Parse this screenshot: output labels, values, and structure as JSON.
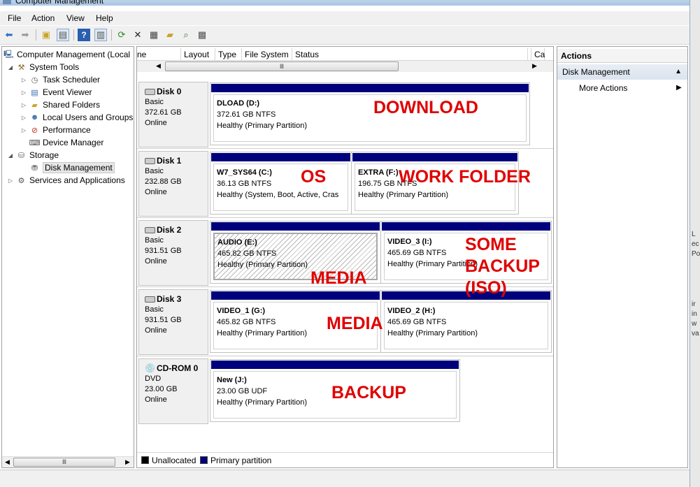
{
  "window": {
    "title": "Computer Management"
  },
  "menu": [
    "File",
    "Action",
    "View",
    "Help"
  ],
  "tree": {
    "items": [
      {
        "label": "Computer Management (Local",
        "level": 0,
        "icon": "computer-icon",
        "twisty": ""
      },
      {
        "label": "System Tools",
        "level": 1,
        "icon": "tools-icon",
        "twisty": "◢"
      },
      {
        "label": "Task Scheduler",
        "level": 2,
        "icon": "clock-icon",
        "twisty": "▷"
      },
      {
        "label": "Event Viewer",
        "level": 2,
        "icon": "event-viewer-icon",
        "twisty": "▷"
      },
      {
        "label": "Shared Folders",
        "level": 2,
        "icon": "shared-folder-icon",
        "twisty": "▷"
      },
      {
        "label": "Local Users and Groups",
        "level": 2,
        "icon": "users-icon",
        "twisty": "▷"
      },
      {
        "label": "Performance",
        "level": 2,
        "icon": "performance-icon",
        "twisty": "▷"
      },
      {
        "label": "Device Manager",
        "level": 2,
        "icon": "device-manager-icon",
        "twisty": ""
      },
      {
        "label": "Storage",
        "level": 1,
        "icon": "storage-icon",
        "twisty": "◢"
      },
      {
        "label": "Disk Management",
        "level": 2,
        "icon": "disk-icon",
        "twisty": "",
        "selected": true
      },
      {
        "label": "Services and Applications",
        "level": 1,
        "icon": "services-icon",
        "twisty": "▷"
      }
    ],
    "scroll_thumb_glyph": "Ⅲ"
  },
  "columns": [
    "ne",
    "Layout",
    "Type",
    "File System",
    "Status",
    "Ca"
  ],
  "hscroll_glyph": "Ⅲ",
  "disks": [
    {
      "name": "Disk 0",
      "type": "Basic",
      "size": "372.61 GB",
      "status": "Online",
      "partitions": [
        {
          "name": "DLOAD  (D:)",
          "size_fs": "372.61 GB NTFS",
          "health": "Healthy (Primary Partition)",
          "hatched": false
        }
      ]
    },
    {
      "name": "Disk 1",
      "type": "Basic",
      "size": "232.88 GB",
      "status": "Online",
      "partitions": [
        {
          "name": "W7_SYS64  (C:)",
          "size_fs": "36.13 GB NTFS",
          "health": "Healthy (System, Boot, Active, Cras",
          "hatched": false
        },
        {
          "name": "EXTRA  (F:)",
          "size_fs": "196.75 GB NTFS",
          "health": "Healthy (Primary Partition)",
          "hatched": false
        }
      ]
    },
    {
      "name": "Disk 2",
      "type": "Basic",
      "size": "931.51 GB",
      "status": "Online",
      "partitions": [
        {
          "name": "AUDIO  (E:)",
          "size_fs": "465.82 GB NTFS",
          "health": "Healthy (Primary Partition)",
          "hatched": true
        },
        {
          "name": "VIDEO_3  (I:)",
          "size_fs": "465.69 GB NTFS",
          "health": "Healthy (Primary Partition)",
          "hatched": false
        }
      ]
    },
    {
      "name": "Disk 3",
      "type": "Basic",
      "size": "931.51 GB",
      "status": "Online",
      "partitions": [
        {
          "name": "VIDEO_1  (G:)",
          "size_fs": "465.82 GB NTFS",
          "health": "Healthy (Primary Partition)",
          "hatched": false
        },
        {
          "name": "VIDEO_2  (H:)",
          "size_fs": "465.69 GB NTFS",
          "health": "Healthy (Primary Partition)",
          "hatched": false
        }
      ]
    },
    {
      "name": "CD-ROM 0",
      "type": "DVD",
      "size": "23.00 GB",
      "status": "Online",
      "partitions": [
        {
          "name": "New  (J:)",
          "size_fs": "23.00 GB UDF",
          "health": "Healthy (Primary Partition)",
          "hatched": false
        }
      ]
    }
  ],
  "annotations": {
    "download": "DOWNLOAD",
    "os": "OS",
    "work_folder": "WORK FOLDER",
    "some_backup": "SOME\nBACKUP\n(ISO)",
    "media_1": "MEDIA",
    "media_2": "MEDIA",
    "backup": "BACKUP",
    "color": "#e00000"
  },
  "legend": {
    "unallocated": "Unallocated",
    "primary": "Primary partition",
    "unallocated_color": "#000000",
    "primary_color": "#00007c"
  },
  "actions": {
    "header": "Actions",
    "section": "Disk Management",
    "more": "More Actions"
  },
  "strip_text": [
    "L",
    "ec",
    "Po",
    "ir",
    "in",
    "w",
    "va"
  ]
}
